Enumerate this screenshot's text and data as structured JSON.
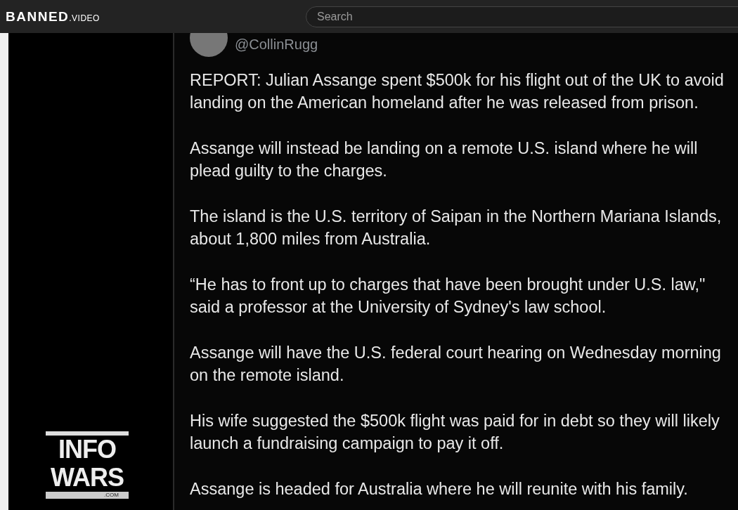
{
  "header": {
    "logo": {
      "main": "BANNED",
      "suffix": ".VIDEO"
    },
    "search": {
      "placeholder": "Search"
    }
  },
  "video": {
    "tweet": {
      "handle": "@CollinRugg",
      "paragraphs": [
        "REPORT: Julian Assange spent $500k for his flight out of the UK to avoid landing on the American homeland after he was released from prison.",
        "Assange will instead be landing on a remote U.S. island where he will plead guilty to the charges.",
        "The island is the U.S. territory of Saipan in the Northern Mariana Islands, about 1,800 miles from Australia.",
        "“He has to front up to charges that have been brought under U.S. law,\" said a professor at the University of Sydney's law school.",
        "Assange will have the U.S. federal court hearing on Wednesday morning on the remote island.",
        "His wife suggested the $500k flight was paid for in debt so they will likely launch a fundraising campaign to pay it off.",
        "Assange is headed for Australia where he will reunite with his family."
      ]
    },
    "watermark_logo": {
      "line_1": "INFO",
      "line_2": "WARS",
      "domain": ".COM"
    }
  }
}
